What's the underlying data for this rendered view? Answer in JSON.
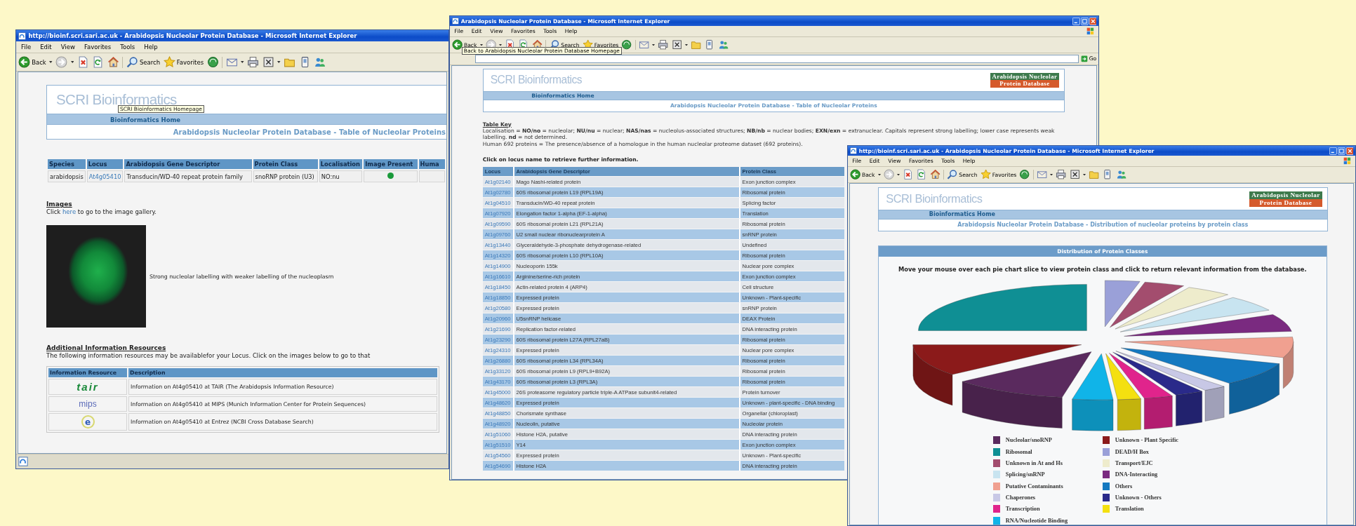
{
  "gene_window": {
    "title": "http://bioinf.scri.sari.ac.uk - Arabidopsis Nucleolar Protein Database - Microsoft Internet Explorer",
    "menu": [
      "File",
      "Edit",
      "View",
      "Favorites",
      "Tools",
      "Help"
    ],
    "toolbar": {
      "back_label": "Back",
      "search_label": "Search",
      "favorites_label": "Favorites"
    },
    "header": {
      "brand": "SCRI Bioinformatics",
      "nav_link": "Bioinformatics Home",
      "page_title": "Arabidopsis Nucleolar Protein Database - Table of Nucleolar Proteins"
    },
    "tooltip": "SCRI Bioinformatics Homepage",
    "locus_table": {
      "columns": [
        "Species",
        "Locus",
        "Arabidopsis Gene Descriptor",
        "Protein Class",
        "Localisation",
        "Image Present",
        "Huma"
      ],
      "rows": [
        {
          "species": "arabidopsis",
          "locus": "At4g05410",
          "descriptor": "Transducin/WD-40 repeat protein family",
          "protein_class": "snoRNP protein (U3)",
          "localisation": "NO:nu",
          "image_present": true
        }
      ]
    },
    "images": {
      "heading": "Images",
      "text_before": "Click",
      "link": "here",
      "text_after": "to go to the image gallery.",
      "caption": "Strong nucleolar labelling with weaker labelling of the nucleoplasm"
    },
    "resources": {
      "heading": "Additional Information Resources",
      "intro": "The following information resources may be availablefor your Locus. Click on the images below to go to that",
      "columns": [
        "Information Resource",
        "Description"
      ],
      "rows": [
        {
          "kind": "wordmark",
          "logo": "tair",
          "description": "Information on At4g05410 at TAIR (The Arabidopsis Information Resource)"
        },
        {
          "kind": "light_wordmark",
          "logo": "mips",
          "description": "Information on At4g05410 at MIPS (Munich Information Center for Protein Sequences)"
        },
        {
          "kind": "round_badge",
          "logo": "e",
          "description": "Information on At4g05410 at Entrez (NCBI Cross Database Search)"
        }
      ]
    }
  },
  "list_window": {
    "title": "Arabidopsis Nucleolar Protein Database - Microsoft Internet Explorer",
    "menu": [
      "File",
      "Edit",
      "View",
      "Favorites",
      "Tools",
      "Help"
    ],
    "toolbar": {
      "back_label": "Back",
      "search_label": "Search",
      "favorites_label": "Favorites"
    },
    "address_go": "Go",
    "tooltip": "Back to Arabidopsis Nucleolar Protein Database Homepage",
    "header": {
      "brand": "SCRI Bioinformatics",
      "nav_link": "Bioinformatics Home",
      "page_title": "Arabidopsis Nucleolar Protein Database - Table of Nucleolar Proteins",
      "logo": [
        "Arabidopsis Nucleolar",
        "Protein Database"
      ]
    },
    "key": {
      "heading": "Table Key",
      "lines": [
        "Localisation = **NO/no** = nucleolar; **NU/nu** = nuclear; **NAS/nas** = nucleolus-associated structures; **NB/nb** = nuclear bodies; **EXN/exn** = extranuclear. Capitals represent strong labelling; lower case represents weak labelling. **nd** = not determined.",
        "Human 692 proteins = The presence/absence of a homologue in the human nucleolar proteome dataset (692 proteins)."
      ]
    },
    "instruction": "Click on locus name to retrieve further information.",
    "table": {
      "columns": [
        "Locus",
        "Arabidopsis Gene Descriptor",
        "Protein Class"
      ],
      "rows": [
        {
          "locus": "At1g02140",
          "descriptor": "Mago Nashi-related protein",
          "protein_class": "Exon junction complex"
        },
        {
          "locus": "At1g02780",
          "descriptor": "60S ribosomal protein L19 (RPL19A)",
          "protein_class": "Ribosomal protein"
        },
        {
          "locus": "At1g04510",
          "descriptor": "Transducin/WD-40 repeat protein",
          "protein_class": "Splicing factor"
        },
        {
          "locus": "At1g07920",
          "descriptor": "Elongation factor 1-alpha (EF-1-alpha)",
          "protein_class": "Translation"
        },
        {
          "locus": "At1g09590",
          "descriptor": "60S ribosomal protein L21 (RPL21A)",
          "protein_class": "Ribosomal protein"
        },
        {
          "locus": "At1g09760",
          "descriptor": "U2 small nuclear ribonuclearprotein A",
          "protein_class": "snRNP protein"
        },
        {
          "locus": "At1g13440",
          "descriptor": "Glyceraldehyde-3-phosphate dehydrogenase-related",
          "protein_class": "Undefined"
        },
        {
          "locus": "At1g14320",
          "descriptor": "60S ribosomal protein L10 (RPL10A)",
          "protein_class": "Ribosomal protein"
        },
        {
          "locus": "At1g14900",
          "descriptor": "Nucleoporin 155k",
          "protein_class": "Nuclear pore complex"
        },
        {
          "locus": "At1g16610",
          "descriptor": "Arginine/serine-rich protein",
          "protein_class": "Exon junction complex"
        },
        {
          "locus": "At1g18450",
          "descriptor": "Actin-related protein 4 (ARP4)",
          "protein_class": "Cell structure"
        },
        {
          "locus": "At1g18850",
          "descriptor": "Expressed protein",
          "protein_class": "Unknown - Plant-specific"
        },
        {
          "locus": "At1g20580",
          "descriptor": "Expressed protein",
          "protein_class": "snRNP protein"
        },
        {
          "locus": "At1g20960",
          "descriptor": "U5snRNP helicase",
          "protein_class": "DEAX Protein"
        },
        {
          "locus": "At1g21690",
          "descriptor": "Replication factor-related",
          "protein_class": "DNA interacting protein"
        },
        {
          "locus": "At1g23290",
          "descriptor": "60S ribosomal protein L27A (RPL27aB)",
          "protein_class": "Ribosomal protein"
        },
        {
          "locus": "At1g24310",
          "descriptor": "Expressed protein",
          "protein_class": "Nuclear pore complex"
        },
        {
          "locus": "At1g26880",
          "descriptor": "60S ribosomal protein L34 (RPL34A)",
          "protein_class": "Ribosomal protein"
        },
        {
          "locus": "At1g33120",
          "descriptor": "60S ribosomal protein L9 (RPL9+B92A)",
          "protein_class": "Ribosomal protein"
        },
        {
          "locus": "At1g43170",
          "descriptor": "60S ribosomal protein L3 (RPL3A)",
          "protein_class": "Ribosomal protein"
        },
        {
          "locus": "At1g45000",
          "descriptor": "26S proteasome regulatory particle triple-A ATPase subunit4-related",
          "protein_class": "Protein turnover"
        },
        {
          "locus": "At1g48620",
          "descriptor": "Expressed protein",
          "protein_class": "Unknown - plant-specific - DNA binding"
        },
        {
          "locus": "At1g48850",
          "descriptor": "Chorismate synthase",
          "protein_class": "Organellar (chloroplast)"
        },
        {
          "locus": "At1g48920",
          "descriptor": "Nucleolin, putative",
          "protein_class": "Nucleolar protein"
        },
        {
          "locus": "At1g51060",
          "descriptor": "Histone H2A, putative",
          "protein_class": "DNA interacting protein"
        },
        {
          "locus": "At1g51510",
          "descriptor": "Y14",
          "protein_class": "Exon junction complex"
        },
        {
          "locus": "At1g54560",
          "descriptor": "Expressed protein",
          "protein_class": "Unknown - Plant-specific"
        },
        {
          "locus": "At1g54690",
          "descriptor": "Histone H2A",
          "protein_class": "DNA interacting protein"
        }
      ]
    }
  },
  "chart_window": {
    "title": "http://bioinf.scri.sari.ac.uk - Arabidopsis Nucleolar Protein Database - Microsoft Internet Explorer",
    "menu": [
      "File",
      "Edit",
      "View",
      "Favorites",
      "Tools",
      "Help"
    ],
    "toolbar": {
      "back_label": "Back",
      "search_label": "Search",
      "favorites_label": "Favorites"
    },
    "header": {
      "brand": "SCRI Bioinformatics",
      "nav_link": "Bioinformatics Home",
      "page_title": "Arabidopsis Nucleolar Protein Database - Distribution of nucleolar proteins by protein class",
      "logo": [
        "Arabidopsis Nucleolar",
        "Protein Database"
      ]
    },
    "section": {
      "title": "Distribution of Protein Classes",
      "instruction": "Move your mouse over each pie chart slice to view protein class and click to return relevant information from the database.",
      "legend": [
        {
          "label": "Nucleolar/snoRNP",
          "color": "#5a2a5e"
        },
        {
          "label": "Ribosomal",
          "color": "#0f8f94"
        },
        {
          "label": "Unknown in At and Hs",
          "color": "#a34d6e"
        },
        {
          "label": "Splicing/snRNP",
          "color": "#c8e4f0"
        },
        {
          "label": "Putative Contaminants",
          "color": "#f0a090"
        },
        {
          "label": "Chaperones",
          "color": "#c8c8e6"
        },
        {
          "label": "Transcription",
          "color": "#e0248c"
        },
        {
          "label": "RNA/Nucleotide Binding",
          "color": "#10b4e8"
        },
        {
          "label": "Unknown - Plant Specific",
          "color": "#8b1a1a"
        },
        {
          "label": "DEAD/H Box",
          "color": "#9aa0d8"
        },
        {
          "label": "Transport/EJC",
          "color": "#eeeccc"
        },
        {
          "label": "DNA-Interacting",
          "color": "#7a2a80"
        },
        {
          "label": "Others",
          "color": "#1479c0"
        },
        {
          "label": "Unknown - Others",
          "color": "#2a2a8a"
        },
        {
          "label": "Translation",
          "color": "#f4e010"
        }
      ]
    }
  }
}
